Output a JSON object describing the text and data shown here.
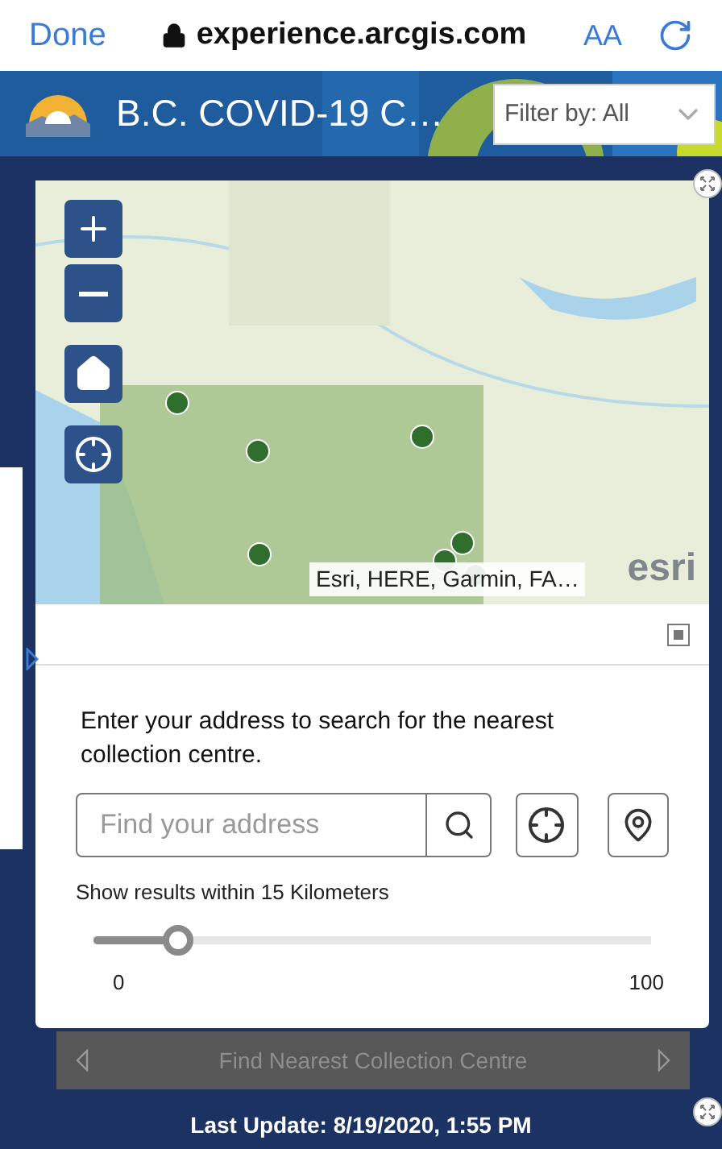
{
  "browser": {
    "done": "Done",
    "url": "experience.arcgis.com",
    "text_size": "AA"
  },
  "header": {
    "title": "B.C. COVID-19 C…",
    "filter": {
      "label": "Filter by: All"
    }
  },
  "map": {
    "attribution": "Esri, HERE, Garmin, FA…",
    "logo": "esri"
  },
  "panel": {
    "instructions": "Enter your address to search for the nearest collection centre.",
    "search": {
      "placeholder": "Find your address"
    },
    "radius": {
      "label": "Show results within 15 Kilometers",
      "level": 0.15,
      "min": "0",
      "max": "100"
    }
  },
  "pager": {
    "title": "Find Nearest Collection Centre"
  },
  "footer": "Last Update: 8/19/2020, 1:55 PM"
}
